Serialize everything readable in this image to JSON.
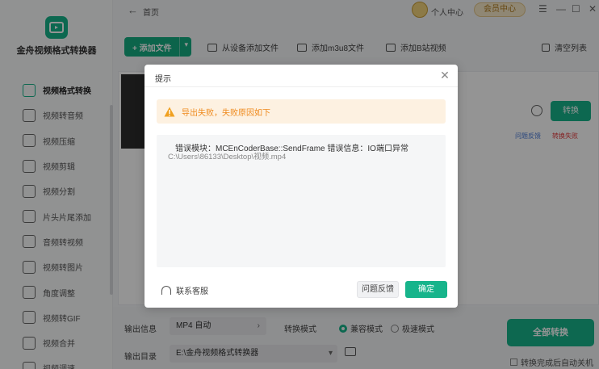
{
  "app": {
    "name": "金舟视频格式转换器",
    "breadcrumb": "首页",
    "user_center": "个人中心",
    "vip_center": "会员中心"
  },
  "sidebar": {
    "items": [
      {
        "label": "视频格式转换",
        "icon": "swap-icon",
        "active": true
      },
      {
        "label": "视频转音频",
        "icon": "music-icon"
      },
      {
        "label": "视频压缩",
        "icon": "compress-icon"
      },
      {
        "label": "视频剪辑",
        "icon": "scissors-icon"
      },
      {
        "label": "视频分割",
        "icon": "split-icon"
      },
      {
        "label": "片头片尾添加",
        "icon": "film-icon"
      },
      {
        "label": "音频转视频",
        "icon": "disc-icon"
      },
      {
        "label": "视频转图片",
        "icon": "image-icon"
      },
      {
        "label": "角度调整",
        "icon": "rotate-icon"
      },
      {
        "label": "视频转GIF",
        "icon": "gif-icon"
      },
      {
        "label": "视频合并",
        "icon": "merge-icon"
      },
      {
        "label": "视频调速",
        "icon": "speed-icon"
      }
    ]
  },
  "toolbar": {
    "add_file": "+ 添加文件",
    "add_from_device": "从设备添加文件",
    "add_m3u8": "添加m3u8文件",
    "add_bilibili": "添加B站视频",
    "clear_list": "清空列表"
  },
  "task": {
    "convert": "转换",
    "feedback": "问题反馈",
    "status": "转换失败"
  },
  "bottom": {
    "output_info_label": "输出信息",
    "output_format": "MP4 自动",
    "mode_label": "转换模式",
    "mode_compat": "兼容模式",
    "mode_fast": "极速模式",
    "output_dir_label": "输出目录",
    "output_dir": "E:\\金舟视频格式转换器",
    "convert_all": "全部转换",
    "shutdown_after": "转换完成后自动关机"
  },
  "dialog": {
    "title": "提示",
    "warning": "导出失败，失败原因如下",
    "error_line": "错误模块：MCEnCoderBase::SendFrame 错误信息：IO端口异常",
    "path_line": "C:\\Users\\86133\\Desktop\\视频.mp4",
    "support": "联系客服",
    "feedback": "问题反馈",
    "ok": "确定"
  },
  "colors": {
    "accent": "#17b48b",
    "warning": "#ef8a1d",
    "error": "#e4393c"
  }
}
